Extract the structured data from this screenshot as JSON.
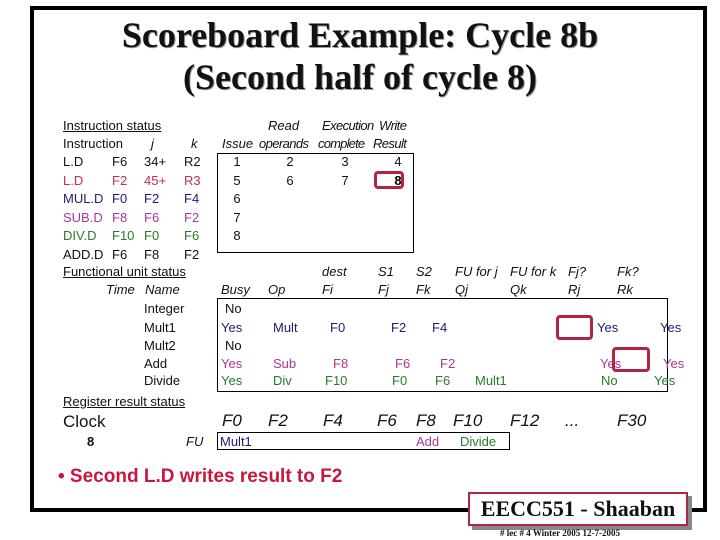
{
  "title": {
    "line1": "Scoreboard Example:  Cycle 8b",
    "line2": "(Second half of cycle 8)"
  },
  "colors": {
    "accent_red": "#c8173f",
    "highlight_box": "#b0263f",
    "inst_ld2": "#c03048",
    "inst_muld": "#1c1c70",
    "inst_subd": "#b03590",
    "inst_divd": "#2a7a2a"
  },
  "instruction_status": {
    "section_label": "Instruction status",
    "headers": {
      "instruction": "Instruction",
      "j": "j",
      "k": "k",
      "issue": "Issue",
      "read_top": "Read",
      "read_bottom": "operands",
      "exec_top": "Execution",
      "exec_bottom": "complete",
      "write_top": "Write",
      "write_bottom": "Result"
    },
    "rows": [
      {
        "op": "L.D",
        "dest": "F6",
        "j": "34+",
        "k": "R2",
        "issue": "1",
        "read": "2",
        "exec": "3",
        "write": "4"
      },
      {
        "op": "L.D",
        "dest": "F2",
        "j": "45+",
        "k": "R3",
        "issue": "5",
        "read": "6",
        "exec": "7",
        "write": "8"
      },
      {
        "op": "MUL.D",
        "dest": "F0",
        "j": "F2",
        "k": "F4",
        "issue": "6",
        "read": "",
        "exec": "",
        "write": ""
      },
      {
        "op": "SUB.D",
        "dest": "F8",
        "j": "F6",
        "k": "F2",
        "issue": "7",
        "read": "",
        "exec": "",
        "write": ""
      },
      {
        "op": "DIV.D",
        "dest": "F10",
        "j": "F0",
        "k": "F6",
        "issue": "8",
        "read": "",
        "exec": "",
        "write": ""
      },
      {
        "op": "ADD.D",
        "dest": "F6",
        "j": "F8",
        "k": "F2",
        "issue": "",
        "read": "",
        "exec": "",
        "write": ""
      }
    ]
  },
  "functional_unit_status": {
    "section_label": "Functional unit status",
    "headers": {
      "time": "Time",
      "name": "Name",
      "busy": "Busy",
      "op": "Op",
      "dest_top": "dest",
      "dest_bottom": "Fi",
      "s1_top": "S1",
      "s1_bottom": "Fj",
      "s2_top": "S2",
      "s2_bottom": "Fk",
      "fuj_top": "FU for j",
      "fuj_bottom": "Qj",
      "fuk_top": "FU for k",
      "fuk_bottom": "Qk",
      "rj_top": "Fj?",
      "rj_bottom": "Rj",
      "rk_top": "Fk?",
      "rk_bottom": "Rk"
    },
    "rows": [
      {
        "time": "",
        "name": "Integer",
        "busy": "No",
        "op": "",
        "fi": "",
        "fj": "",
        "fk": "",
        "qj": "",
        "qk": "",
        "rj": "",
        "rk": ""
      },
      {
        "time": "",
        "name": "Mult1",
        "busy": "Yes",
        "op": "Mult",
        "fi": "F0",
        "fj": "F2",
        "fk": "F4",
        "qj": "",
        "qk": "",
        "rj": "Yes",
        "rk": "Yes"
      },
      {
        "time": "",
        "name": "Mult2",
        "busy": "No",
        "op": "",
        "fi": "",
        "fj": "",
        "fk": "",
        "qj": "",
        "qk": "",
        "rj": "",
        "rk": ""
      },
      {
        "time": "",
        "name": "Add",
        "busy": "Yes",
        "op": "Sub",
        "fi": "F8",
        "fj": "F6",
        "fk": "F2",
        "qj": "",
        "qk": "",
        "rj": "Yes",
        "rk": "Yes"
      },
      {
        "time": "",
        "name": "Divide",
        "busy": "Yes",
        "op": "Div",
        "fi": "F10",
        "fj": "F0",
        "fk": "F6",
        "qj": "Mult1",
        "qk": "",
        "rj": "No",
        "rk": "Yes"
      }
    ]
  },
  "register_result_status": {
    "section_label": "Register result status",
    "clock_label": "Clock",
    "clock_value": "8",
    "fu_label": "FU",
    "registers": [
      "F0",
      "F2",
      "F4",
      "F6",
      "F8",
      "F10",
      "F12",
      "...",
      "F30"
    ],
    "fu_values": [
      "Mult1",
      "",
      "",
      "",
      "Add",
      "Divide",
      "",
      "",
      ""
    ]
  },
  "bullet": "• Second L.D writes result to F2",
  "logo": "EECC551 - Shaaban",
  "footer": "#  lec # 4  Winter 2005    12-7-2005"
}
